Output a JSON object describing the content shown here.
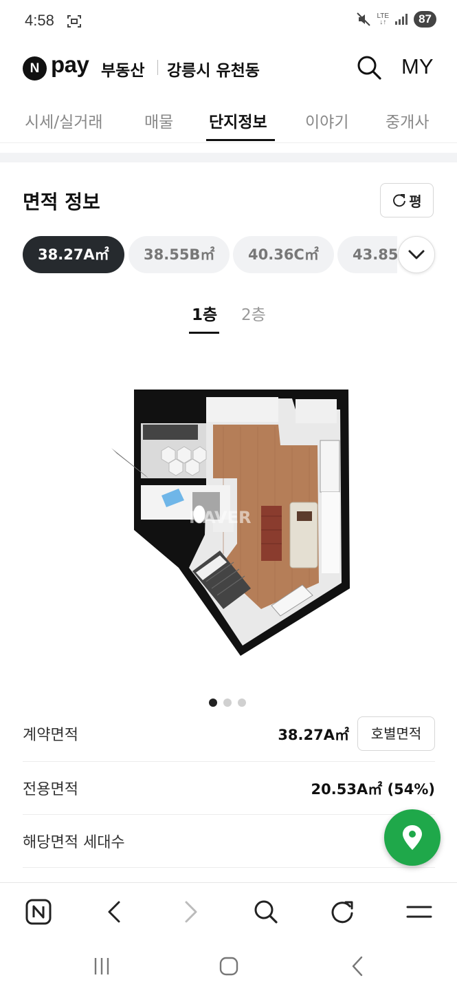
{
  "status_bar": {
    "time": "4:58",
    "network": "LTE",
    "battery": "87"
  },
  "header": {
    "brand_n": "N",
    "brand_pay": "pay",
    "brand_service": "부동산",
    "location": "강릉시 유천동",
    "my_label": "MY"
  },
  "tabs": [
    "시세/실거래",
    "매물",
    "단지정보",
    "이야기",
    "중개사"
  ],
  "active_tab": "단지정보",
  "area_section": {
    "title": "면적 정보",
    "unit_toggle_label": "평",
    "area_chips": [
      "38.27A㎡",
      "38.55B㎡",
      "40.36C㎡",
      "43.85"
    ],
    "floor_tabs": [
      "1층",
      "2층"
    ],
    "watermark": "NAVER"
  },
  "info_rows": {
    "contract_area": {
      "label": "계약면적",
      "value": "38.27A㎡",
      "button": "호별면적"
    },
    "exclusive_area": {
      "label": "전용면적",
      "value": "20.53A㎡ (54%)"
    },
    "households": {
      "label": "해당면적 세대수"
    }
  },
  "colors": {
    "selected_chip": "#262a2e",
    "map_fab": "#1fa84a",
    "active_tab_text": "#111111"
  },
  "icons": {
    "toolbar": [
      "naver-home-icon",
      "back-icon",
      "forward-icon",
      "search-icon",
      "refresh-icon",
      "menu-icon"
    ],
    "system_nav": [
      "recent-apps-icon",
      "home-icon",
      "back-icon"
    ]
  }
}
